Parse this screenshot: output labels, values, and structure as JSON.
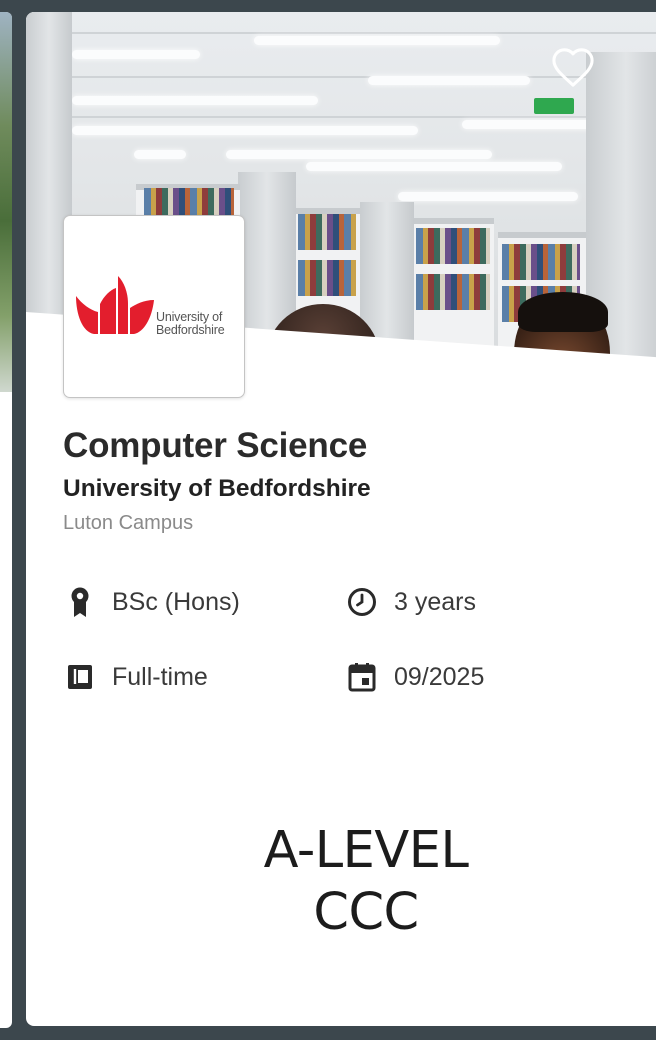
{
  "course": {
    "title": "Computer Science",
    "university": "University of Bedfordshire",
    "campus": "Luton Campus",
    "logo": {
      "line1": "University of",
      "line2": "Bedfordshire",
      "color": "#e31e2d"
    },
    "details": {
      "award": {
        "icon": "award-ribbon-icon",
        "value": "BSc (Hons)"
      },
      "duration": {
        "icon": "clock-icon",
        "value": "3 years"
      },
      "study_mode": {
        "icon": "book-icon",
        "value": "Full-time"
      },
      "start_date": {
        "icon": "calendar-icon",
        "value": "09/2025"
      }
    },
    "entry_requirements": {
      "qualification": "A-LEVEL",
      "grades": "CCC"
    }
  },
  "favourite": {
    "icon": "heart-outline-icon",
    "active": false
  }
}
